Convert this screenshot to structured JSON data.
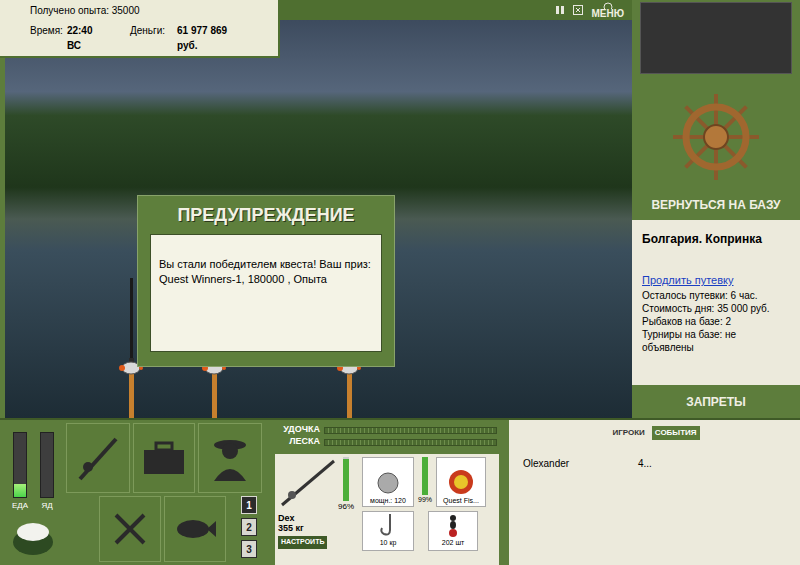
{
  "stats": {
    "experience": "Получено опыта: 35000",
    "time_label": "Время:",
    "time": "22:40 ВС",
    "money_label": "Деньги:",
    "money": "61 977 869 руб."
  },
  "toolbar": {
    "menu": "МЕНЮ"
  },
  "dialog": {
    "title": "ПРЕДУПРЕЖДЕНИЕ",
    "message": "Вы стали победителем квеста! Ваш приз: Quest Winners-1, 180000 , Опыта"
  },
  "rods_in_water": [
    {
      "cast": true
    },
    {
      "cast": true
    },
    {
      "cast": true
    }
  ],
  "base": {
    "return_button": "ВЕРНУТЬСЯ НА БАЗУ",
    "location": "Болгария. Копринка",
    "extend_link": "Продлить путевку",
    "details": [
      "Осталось путевки: 6 час.",
      "Стоимость дня: 35 000 руб.",
      "Рыбаков на базе: 2",
      "Турниры на базе: не объявлены"
    ],
    "bans_button": "ЗАПРЕТЫ"
  },
  "gauges": [
    {
      "label": "ЕДА",
      "level": 0.2
    },
    {
      "label": "ЯД",
      "level": 0
    }
  ],
  "slots": [
    {
      "label": "1",
      "selected": true
    },
    {
      "label": "2",
      "selected": false
    },
    {
      "label": "3",
      "selected": false
    }
  ],
  "tackle": {
    "bars": [
      {
        "label": "УДОЧКА",
        "level": 0
      },
      {
        "label": "ЛЕСКА",
        "level": 0
      }
    ],
    "rod": {
      "name": "Dex",
      "load": "355 кг",
      "condition": "96%",
      "level": 0.96
    },
    "tune_button": "НАСТРОИТЬ",
    "reel": {
      "power": "мощн.: 120",
      "condition": "99%",
      "level": 0.99
    },
    "line": "Quest Fis...",
    "hook": "10 кр",
    "bait": "202 шт"
  },
  "events": {
    "tabs": [
      {
        "label": "ИГРОКИ",
        "selected": false
      },
      {
        "label": "СОБЫТИЯ",
        "selected": true
      }
    ],
    "rows": [
      {
        "name": "Olexander",
        "value": "4..."
      }
    ]
  }
}
